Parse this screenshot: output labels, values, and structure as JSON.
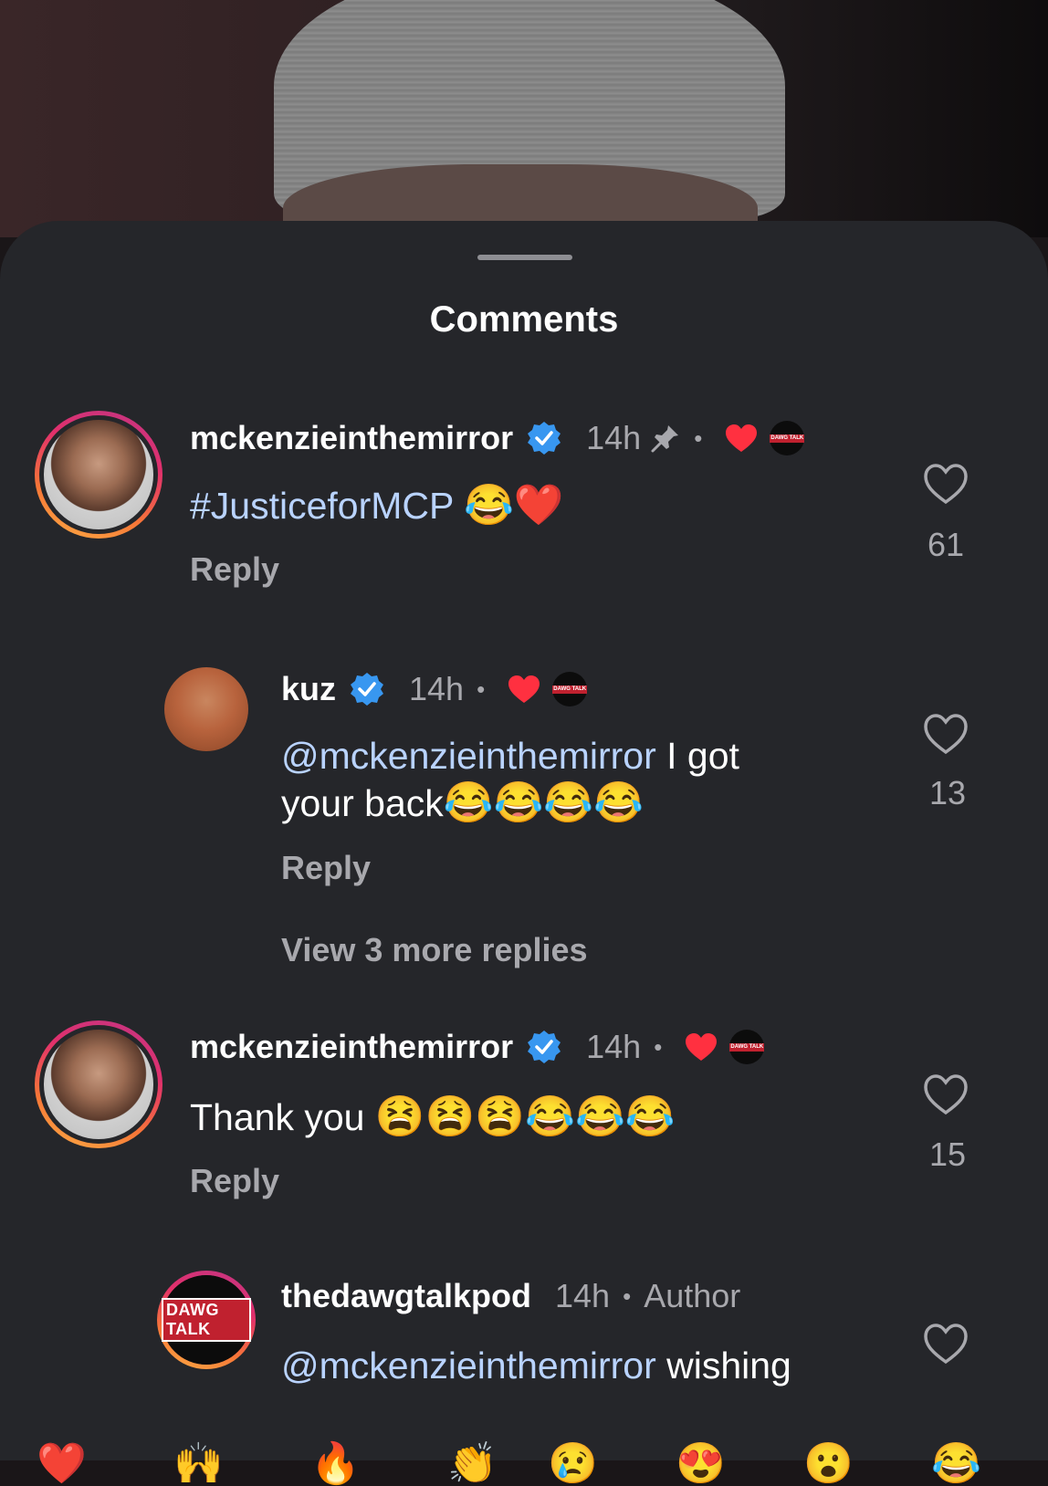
{
  "sheet": {
    "title": "Comments"
  },
  "comments": [
    {
      "username": "mckenzieinthemirror",
      "time": "14h",
      "text": "#JusticeforMCP",
      "emojis": "😂❤️",
      "reply": "Reply",
      "likes": "61",
      "pinned": true,
      "verified": true,
      "badge": "DAWG TALK"
    },
    {
      "username": "kuz",
      "time": "14h",
      "mention": "@mckenzieinthemirror",
      "text_line1": " I got",
      "text_line2": "your back",
      "emojis": "😂😂😂😂",
      "reply": "Reply",
      "likes": "13",
      "verified": true,
      "badge": "DAWG TALK"
    },
    {
      "view_more": "View 3 more replies"
    },
    {
      "username": "mckenzieinthemirror",
      "time": "14h",
      "text": "Thank you",
      "emojis": "😫😫😫😂😂😂",
      "reply": "Reply",
      "likes": "15",
      "verified": true,
      "badge": "DAWG TALK"
    },
    {
      "username": "thedawgtalkpod",
      "time": "14h",
      "author": "Author",
      "mention": "@mckenzieinthemirror",
      "text": " wishing",
      "avatar_logo": "DAWG TALK"
    }
  ],
  "colors": {
    "sheet_bg": "#25262a",
    "mention": "#b9d3ff",
    "muted": "#a8a8ad",
    "verified_blue": "#3897f0",
    "liked_red": "#ff3040"
  }
}
